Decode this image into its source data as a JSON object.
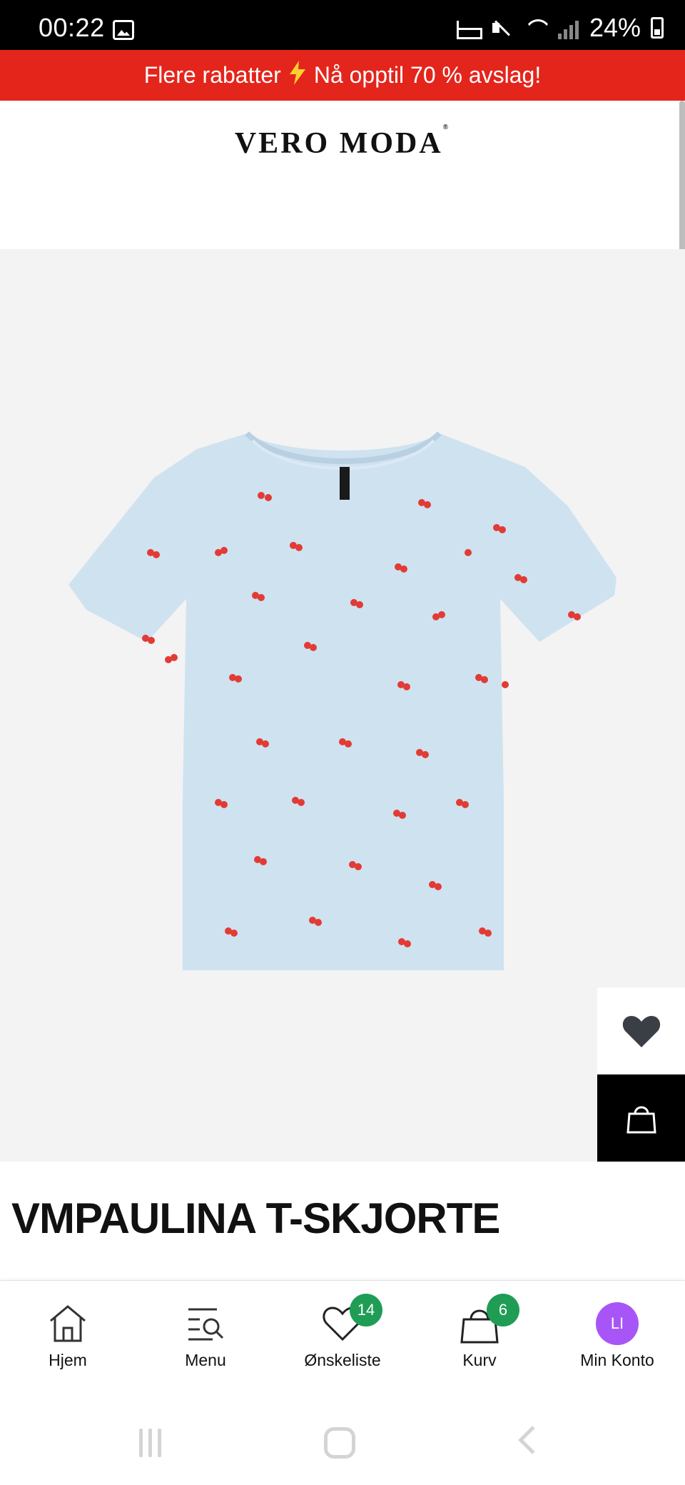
{
  "status_bar": {
    "time": "00:22",
    "battery": "24%",
    "icons": [
      "gallery-icon",
      "sleep-mode-icon",
      "mute-icon",
      "wifi-icon",
      "signal-icon",
      "battery-charging-icon"
    ]
  },
  "promo": {
    "text_before": "Flere rabatter",
    "text_after": "Nå opptil 70 % avslag!",
    "icon": "lightning-icon",
    "background": "#e4251c",
    "icon_color": "#ffcf2e"
  },
  "header": {
    "logo": "VERO MODA",
    "logo_mark": "®"
  },
  "product": {
    "title": "VMPAULINA T-SKJORTE",
    "image_alt": "light blue t-shirt with cherry print",
    "shirt_color": "#cfe2f0",
    "print_color": "#e23b35",
    "carousel": {
      "count": 5,
      "active_index": 0
    }
  },
  "actions": {
    "wishlist_icon": "heart-icon",
    "bag_icon": "shopping-bag-icon"
  },
  "bottom_nav": {
    "items": [
      {
        "label": "Hjem",
        "icon": "home-icon"
      },
      {
        "label": "Menu",
        "icon": "menu-search-icon"
      },
      {
        "label": "Ønskeliste",
        "icon": "heart-outline-icon",
        "badge": "14"
      },
      {
        "label": "Kurv",
        "icon": "bag-outline-icon",
        "badge": "6"
      },
      {
        "label": "Min Konto",
        "avatar": "LI"
      }
    ],
    "badge_color": "#1f9d55",
    "avatar_color": "#a855f7"
  },
  "system_nav": {
    "icons": [
      "recent-apps-icon",
      "home-button-icon",
      "back-icon"
    ]
  }
}
